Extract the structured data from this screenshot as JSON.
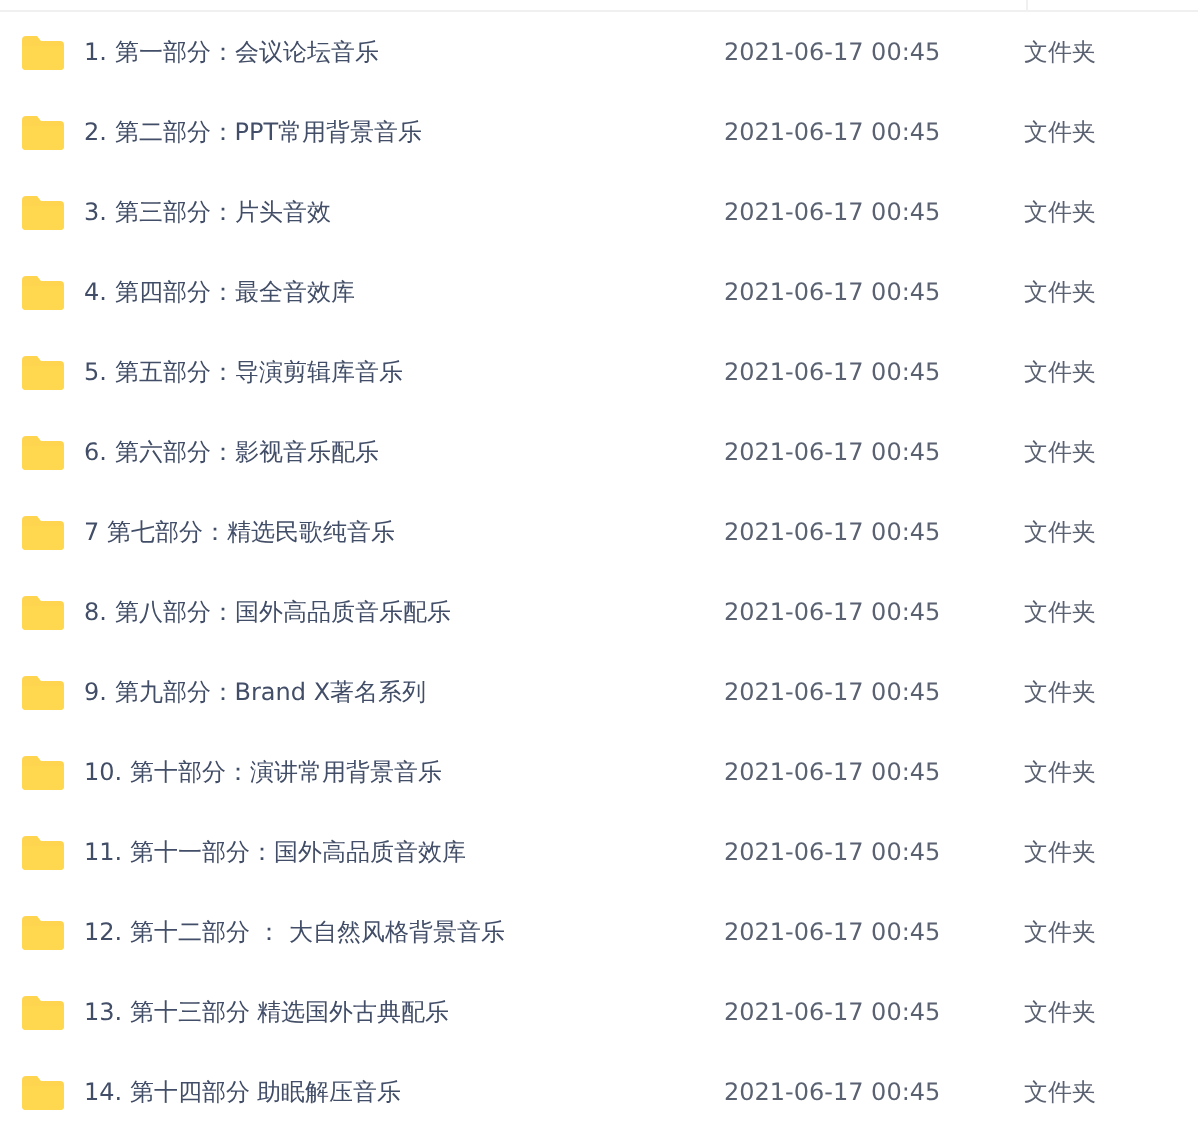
{
  "files": [
    {
      "name": "1. 第一部分：会议论坛音乐",
      "modified": "2021-06-17 00:45",
      "type": "文件夹"
    },
    {
      "name": "2. 第二部分：PPT常用背景音乐",
      "modified": "2021-06-17 00:45",
      "type": "文件夹"
    },
    {
      "name": "3. 第三部分：片头音效",
      "modified": "2021-06-17 00:45",
      "type": "文件夹"
    },
    {
      "name": "4. 第四部分：最全音效库",
      "modified": "2021-06-17 00:45",
      "type": "文件夹"
    },
    {
      "name": "5. 第五部分：导演剪辑库音乐",
      "modified": "2021-06-17 00:45",
      "type": "文件夹"
    },
    {
      "name": "6. 第六部分：影视音乐配乐",
      "modified": "2021-06-17 00:45",
      "type": "文件夹"
    },
    {
      "name": "7 第七部分：精选民歌纯音乐",
      "modified": "2021-06-17 00:45",
      "type": "文件夹"
    },
    {
      "name": "8. 第八部分：国外高品质音乐配乐",
      "modified": "2021-06-17 00:45",
      "type": "文件夹"
    },
    {
      "name": "9. 第九部分：Brand X著名系列",
      "modified": "2021-06-17 00:45",
      "type": "文件夹"
    },
    {
      "name": "10. 第十部分：演讲常用背景音乐",
      "modified": "2021-06-17 00:45",
      "type": "文件夹"
    },
    {
      "name": "11. 第十一部分：国外高品质音效库",
      "modified": "2021-06-17 00:45",
      "type": "文件夹"
    },
    {
      "name": "12. 第十二部分 ： 大自然风格背景音乐",
      "modified": "2021-06-17 00:45",
      "type": "文件夹"
    },
    {
      "name": "13. 第十三部分 精选国外古典配乐",
      "modified": "2021-06-17 00:45",
      "type": "文件夹"
    },
    {
      "name": "14. 第十四部分 助眠解压音乐",
      "modified": "2021-06-17 00:45",
      "type": "文件夹"
    }
  ]
}
